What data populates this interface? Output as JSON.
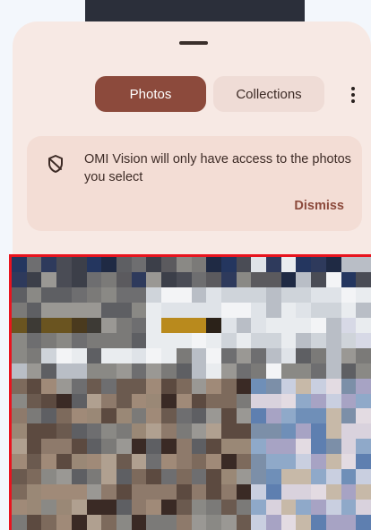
{
  "tabs": {
    "photos_label": "Photos",
    "collections_label": "Collections"
  },
  "notice": {
    "message": "OMI Vision will only have access to the photos you select",
    "dismiss_label": "Dismiss"
  },
  "icons": {
    "overflow": "more-vert-icon",
    "notice": "shield-off-icon"
  },
  "colors": {
    "accent": "#8c4a3c",
    "sheet_background": "#f7e9e4",
    "selection_border": "#e8141e"
  }
}
